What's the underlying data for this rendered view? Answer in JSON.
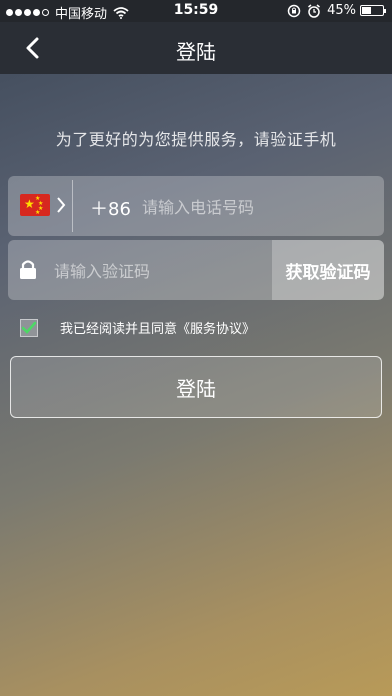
{
  "status_bar": {
    "carrier": "中国移动",
    "time": "15:59",
    "battery": "45%",
    "icons": [
      "signal-dots",
      "wifi-icon",
      "rotation-lock-icon",
      "alarm-icon",
      "battery-icon"
    ]
  },
  "nav": {
    "title": "登陆",
    "back_icon": "chevron-left-icon"
  },
  "hint": "为了更好的为您提供服务，请验证手机",
  "phone": {
    "flag": "china-flag-icon",
    "prefix": "＋86",
    "placeholder": "请输入电话号码",
    "value": ""
  },
  "code": {
    "placeholder": "请输入验证码",
    "value": "",
    "get_code_label": "获取验证码"
  },
  "agreement": {
    "checked": true,
    "text": "我已经阅读并且同意《服务协议》"
  },
  "login_button": "登陆",
  "colors": {
    "checkmark": "#4cd964",
    "flag_red": "#d7281f",
    "flag_star": "#ffde00"
  }
}
